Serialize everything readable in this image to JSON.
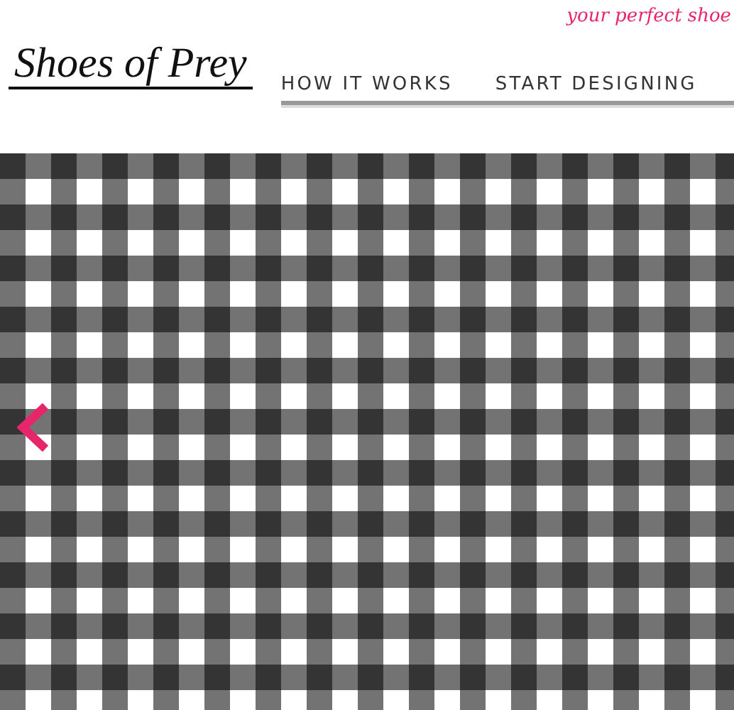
{
  "header": {
    "tagline": "your perfect shoe",
    "logo": "Shoes of Prey",
    "nav": [
      {
        "label": "HOW IT WORKS"
      },
      {
        "label": "START DESIGNING"
      }
    ]
  }
}
